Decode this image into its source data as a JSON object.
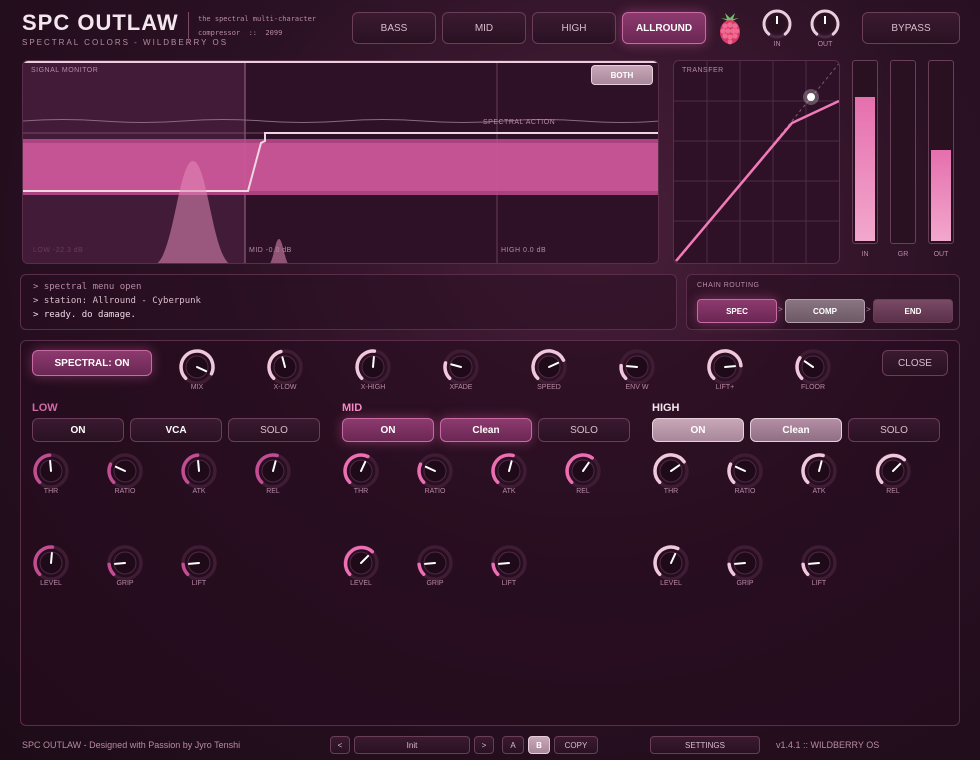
{
  "header": {
    "title": "SPC OUTLAW",
    "subtitle": "SPECTRAL COLORS - WILDBERRY OS",
    "desc_line1": "the spectral multi-character",
    "desc_line2": "compressor  ::  2099",
    "modes": [
      "BASS",
      "MID",
      "HIGH",
      "ALLROUND"
    ],
    "active_mode": "ALLROUND",
    "in_label": "IN",
    "out_label": "OUT",
    "bypass_label": "BYPASS",
    "logo_icon": "raspberry-icon"
  },
  "signal_monitor": {
    "label": "SIGNAL MONITOR",
    "both_label": "BOTH",
    "spectral_action": "SPECTRAL ACTION",
    "band_low": "LOW -22.3 dB",
    "band_mid": "MID -0.0 dB",
    "band_high": "HIGH 0.0 dB"
  },
  "transfer": {
    "label": "TRANSFER"
  },
  "meters": {
    "in_label": "IN",
    "gr_label": "GR",
    "out_label": "OUT",
    "in_level": 0.81,
    "gr_level": 0.0,
    "out_level": 0.51
  },
  "console": {
    "lines": [
      "> spectral menu open",
      "> station: Allround - Cyberpunk",
      "> ready. do damage."
    ]
  },
  "chain": {
    "label": "CHAIN ROUTING",
    "spec": "SPEC",
    "comp": "COMP",
    "end": "END"
  },
  "spectral": {
    "toggle_label": "SPECTRAL: ON",
    "close_label": "CLOSE",
    "knobs": [
      "MIX",
      "X-LOW",
      "X-HIGH",
      "XFADE",
      "SPEED",
      "ENV W",
      "LIFT+",
      "FLOOR"
    ]
  },
  "bands": {
    "low": {
      "title": "LOW",
      "on": "ON",
      "mode": "VCA",
      "solo": "SOLO"
    },
    "mid": {
      "title": "MID",
      "on": "ON",
      "mode": "Clean",
      "solo": "SOLO"
    },
    "high": {
      "title": "HIGH",
      "on": "ON",
      "mode": "Clean",
      "solo": "SOLO"
    },
    "row1_labels": [
      "THR",
      "RATIO",
      "ATK",
      "REL"
    ],
    "row2_labels": [
      "LEVEL",
      "GRIP",
      "LIFT"
    ]
  },
  "footer": {
    "credit": "SPC OUTLAW  -  Designed with Passion by Jyro Tenshi",
    "prev": "<",
    "preset": "Init",
    "next": ">",
    "slot_a": "A",
    "slot_b": "B",
    "copy": "COPY",
    "settings": "SETTINGS",
    "version": "v1.4.1  ::  WILDBERRY OS"
  },
  "colors": {
    "accent": "#e56fae",
    "accent_dim": "#8d3a6e",
    "pale": "#e8cfdc",
    "bg": "#2b1124"
  }
}
